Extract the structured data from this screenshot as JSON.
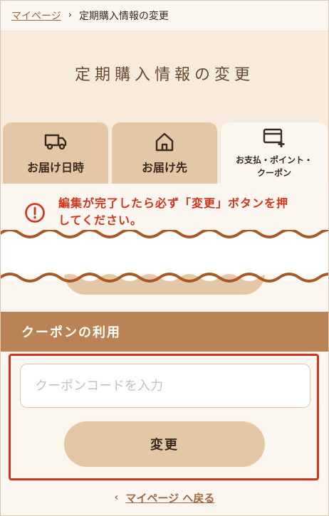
{
  "breadcrumb": {
    "home": "マイページ",
    "separator": "›",
    "current": "定期購入情報の変更"
  },
  "page_title": "定期購入情報の変更",
  "tabs": [
    {
      "label": "お届け日時",
      "icon": "truck-icon",
      "active": false
    },
    {
      "label": "お届け先",
      "icon": "home-icon",
      "active": false
    },
    {
      "label_line1": "お支払・ポイント・",
      "label_line2": "クーポン",
      "icon": "credit-card-plus-icon",
      "active": true
    }
  ],
  "notice": {
    "icon": "alert-circle-icon",
    "line1": "編集が完了したら必ず「変更」ボタンを押",
    "line2": "してください。"
  },
  "coupon": {
    "heading": "クーポンの利用",
    "placeholder": "クーポンコードを入力",
    "value": "",
    "button_label": "変更"
  },
  "back_link": {
    "chevron": "‹",
    "label": "マイページ へ戻る"
  },
  "colors": {
    "accent_brown": "#b98355",
    "tab_bg": "#e4c7a5",
    "alert_red": "#d2341b",
    "link": "#a0673e"
  }
}
